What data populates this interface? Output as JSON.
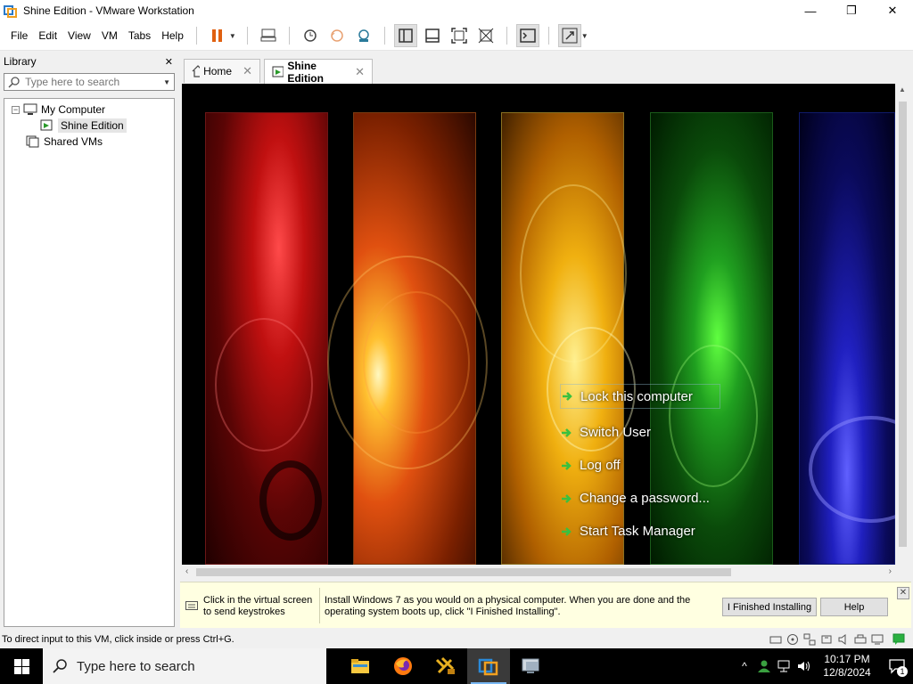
{
  "window": {
    "title": "Shine Edition - VMware Workstation",
    "minimize": "—",
    "maximize": "❐",
    "close": "✕"
  },
  "menu": [
    "File",
    "Edit",
    "View",
    "VM",
    "Tabs",
    "Help"
  ],
  "library": {
    "title": "Library",
    "close": "✕",
    "search_placeholder": "Type here to search",
    "tree": {
      "expander": "−",
      "my_computer": "My Computer",
      "shine_edition": "Shine Edition",
      "shared_vms": "Shared VMs"
    }
  },
  "tabs": {
    "home": "Home",
    "active": "Shine Edition",
    "close": "✕"
  },
  "vm": {
    "options": [
      "Lock this computer",
      "Switch User",
      "Log off",
      "Change a password...",
      "Start Task Manager"
    ]
  },
  "scroll": {
    "up": "▲",
    "left": "‹",
    "right": "›"
  },
  "infobar": {
    "keystroke_hint": "Click in the virtual screen to send keystrokes",
    "message": "Install Windows 7 as you would on a physical computer. When you are done and the operating system boots up, click \"I Finished Installing\".",
    "finished_button": "I Finished Installing",
    "help_button": "Help",
    "close": "✕"
  },
  "status": {
    "text": "To direct input to this VM, click inside or press Ctrl+G."
  },
  "taskbar": {
    "search_placeholder": "Type here to search",
    "time": "10:17 PM",
    "date": "12/8/2024",
    "notification_count": "1",
    "tray_caret": "^"
  },
  "colors": {
    "accent": "#2a7ac9",
    "infobar_bg": "#ffffe1",
    "taskbar_bg": "#000000"
  }
}
